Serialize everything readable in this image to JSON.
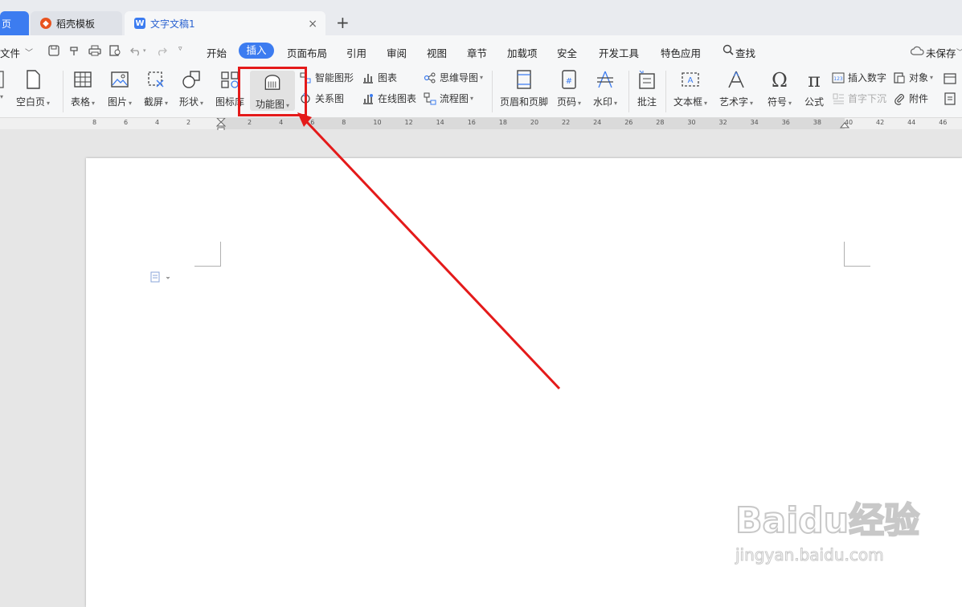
{
  "tabs": {
    "home": "页",
    "template": "稻壳模板",
    "doc": "文字文稿1",
    "add": "+",
    "close": "×"
  },
  "menu": {
    "file": "文件",
    "items": [
      "开始",
      "插入",
      "页面布局",
      "引用",
      "审阅",
      "视图",
      "章节",
      "加载项",
      "安全",
      "开发工具",
      "特色应用"
    ],
    "search": "查找",
    "unsaved": "未保存"
  },
  "ribbon": {
    "blank_page": "空白页",
    "table": "表格",
    "picture": "图片",
    "screenshot": "截屏",
    "shape": "形状",
    "icon_lib": "图标库",
    "function_chart": "功能图",
    "smart_graphic": "智能图形",
    "chart": "图表",
    "mind_map": "思维导图",
    "relation_chart": "关系图",
    "online_chart": "在线图表",
    "flowchart": "流程图",
    "header_footer": "页眉和页脚",
    "page_number": "页码",
    "watermark": "水印",
    "comment": "批注",
    "textbox": "文本框",
    "wordart": "艺术字",
    "symbol": "符号",
    "formula": "公式",
    "insert_number": "插入数字",
    "object": "对象",
    "drop_cap": "首字下沉",
    "attachment": "附件"
  },
  "ruler": {
    "left_labels": [
      "8",
      "6",
      "4",
      "2"
    ],
    "right_labels": [
      "2",
      "4",
      "6",
      "8",
      "10",
      "12",
      "14",
      "16",
      "18",
      "20",
      "22",
      "24",
      "26",
      "28",
      "30",
      "32",
      "34",
      "36",
      "38",
      "40",
      "42",
      "44",
      "46"
    ]
  },
  "watermark": {
    "brand": "Baidu经验",
    "url": "jingyan.baidu.com"
  },
  "colors": {
    "accent": "#3c7cf0",
    "annotation": "#e41a1a"
  }
}
